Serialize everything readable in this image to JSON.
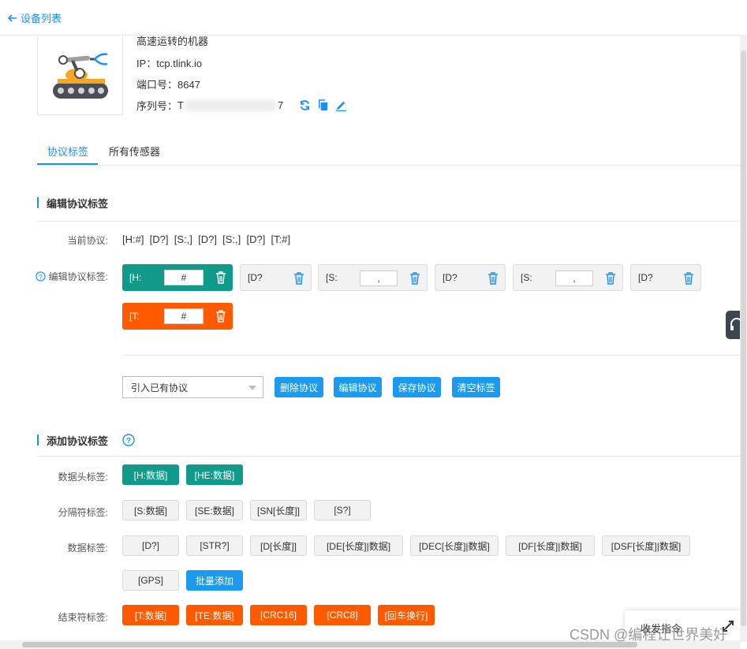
{
  "header": {
    "back_label": "设备列表"
  },
  "device": {
    "name": "高速运转的机器",
    "ip_label": "IP：",
    "ip_value": "tcp.tlink.io",
    "port_label": "端口号：",
    "port_value": "8647",
    "serial_label": "序列号：",
    "serial_prefix": "T",
    "serial_suffix": "7"
  },
  "tabs": [
    {
      "label": "协议标签"
    },
    {
      "label": "所有传感器"
    }
  ],
  "edit_section": {
    "title": "编辑协议标签",
    "current_label": "当前协议:",
    "current_value": "[H:#]  [D?]  [S:,]  [D?]  [S:,]  [D?]  [T:#]",
    "edit_label": "编辑协议标签:",
    "tags": [
      {
        "text": "[H:",
        "input": "#"
      },
      {
        "text": "[D?"
      },
      {
        "text": "[S:",
        "input": ","
      },
      {
        "text": "[D?"
      },
      {
        "text": "[S:",
        "input": ","
      },
      {
        "text": "[D?"
      },
      {
        "text": "[T:",
        "input": "#"
      }
    ],
    "select_value": "引入已有协议",
    "buttons": [
      "删除协议",
      "编辑协议",
      "保存协议",
      "清空标签"
    ]
  },
  "add_section": {
    "title": "添加协议标签",
    "header_label": "数据头标签:",
    "header_tags": [
      "[H:数据]",
      "[HE:数据]"
    ],
    "separator_label": "分隔符标签:",
    "separator_tags": [
      "[S:数据]",
      "[SE:数据]",
      "[SN[长度]]",
      "[S?]"
    ],
    "data_label": "数据标签:",
    "data_tags": [
      "[D?]",
      "[STR?]",
      "[D[长度]]",
      "[DE[长度]|数据]",
      "[DEC[长度]|数据]",
      "[DF[长度]|数据]",
      "[DSF[长度]|数据]",
      "[GPS]"
    ],
    "batch_add": "批量添加",
    "end_label": "结束符标签:",
    "end_tags": [
      "[T:数据]",
      "[TE:数据]",
      "[CRC16]",
      "[CRC8]",
      "[回车换行]"
    ]
  },
  "floating": {
    "command_label": "收发指令"
  },
  "watermark": "CSDN @编程让世界美好",
  "colors": {
    "primary": "#1890ff",
    "teal": "#0f9a8a",
    "orange": "#ff5a00",
    "button_blue": "#1a9bf0"
  },
  "icons": [
    "back-arrow-icon",
    "refresh-icon",
    "copy-icon",
    "edit-icon",
    "help-icon",
    "trash-icon",
    "headset-icon",
    "expand-icon"
  ]
}
